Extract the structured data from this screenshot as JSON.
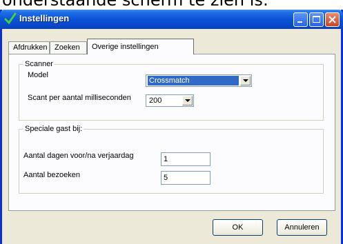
{
  "background_text": "onderstaande scherm te zien is:",
  "window": {
    "title": "Instellingen",
    "controls": [
      "minimize-icon",
      "maximize-icon",
      "close-icon"
    ]
  },
  "tabs": [
    {
      "label": "Afdrukken",
      "active": false
    },
    {
      "label": "Zoeken",
      "active": false
    },
    {
      "label": "Overige instellingen",
      "active": true
    }
  ],
  "scanner": {
    "legend": "Scanner",
    "model_label": "Model",
    "model_value": "Crossmatch",
    "interval_label": "Scant per aantal milliseconden",
    "interval_value": "200"
  },
  "special_guest": {
    "legend": "Speciale gast bij:",
    "days_label": "Aantal dagen voor/na verjaardag",
    "days_value": "1",
    "visits_label": "Aantal bezoeken",
    "visits_value": "5"
  },
  "buttons": {
    "ok": "OK",
    "cancel": "Annuleren"
  },
  "colors": {
    "titlebar": "#0a53d6",
    "selection": "#316ac5",
    "check_icon": "#2fa52f"
  }
}
